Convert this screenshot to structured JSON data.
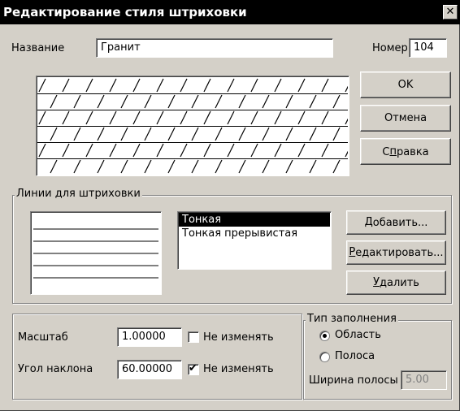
{
  "window": {
    "title": "Редактирование стиля штриховки",
    "close_glyph": "✕"
  },
  "name_field": {
    "label": "Название",
    "value": "Гранит"
  },
  "number_field": {
    "label": "Номер",
    "value": "104"
  },
  "buttons": {
    "ok": "OK",
    "cancel": "Отмена",
    "help_prefix": "С",
    "help_underlined": "п",
    "help_rest": "равка",
    "add_underlined": "Д",
    "add_rest": "обавить...",
    "edit_underlined": "Р",
    "edit_rest": "едактировать...",
    "delete_underlined": "У",
    "delete_rest": "далить"
  },
  "lines_group": {
    "title": "Линии для штриховки",
    "items": [
      {
        "label": "Тонкая",
        "selected": true
      },
      {
        "label": "Тонкая прерывистая",
        "selected": false
      }
    ]
  },
  "scale": {
    "label": "Масштаб",
    "value": "1.00000",
    "lock_label": "Не изменять",
    "lock_checked": false
  },
  "angle": {
    "label": "Угол наклона",
    "value": "60.00000",
    "lock_label": "Не изменять",
    "lock_checked": true
  },
  "fill_group": {
    "title": "Тип заполнения",
    "options": [
      {
        "label": "Область",
        "selected": true
      },
      {
        "label": "Полоса",
        "selected": false
      }
    ],
    "width_label": "Ширина полосы",
    "width_value": "5.00"
  },
  "hatch_preview": {
    "pattern": "granite",
    "angle_deg": 60,
    "rows": 6
  }
}
